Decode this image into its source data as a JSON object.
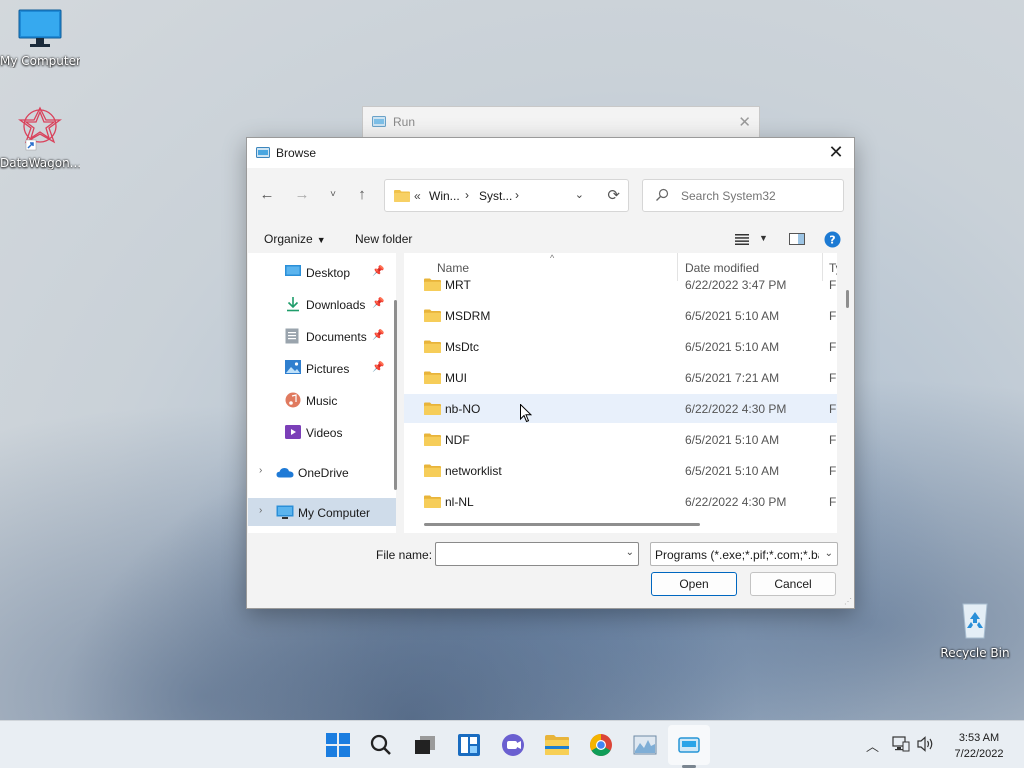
{
  "desktop": {
    "icons": [
      {
        "label": "My Computer"
      },
      {
        "label": "DataWagon..."
      },
      {
        "label": "Recycle Bin"
      }
    ]
  },
  "run_window": {
    "title": "Run"
  },
  "dialog": {
    "title": "Browse",
    "address": {
      "crumb_prefix": "«",
      "crumbs": [
        "Win...",
        "Syst..."
      ]
    },
    "search": {
      "placeholder": "Search System32",
      "value": ""
    },
    "commands": {
      "organize": "Organize",
      "new_folder": "New folder"
    },
    "nav": [
      {
        "label": "Desktop",
        "icon": "desktop-icon",
        "pinned": true
      },
      {
        "label": "Downloads",
        "icon": "downloads-icon",
        "pinned": true
      },
      {
        "label": "Documents",
        "icon": "documents-icon",
        "pinned": true
      },
      {
        "label": "Pictures",
        "icon": "pictures-icon",
        "pinned": true
      },
      {
        "label": "Music",
        "icon": "music-icon",
        "pinned": false
      },
      {
        "label": "Videos",
        "icon": "videos-icon",
        "pinned": false
      },
      {
        "label": "OneDrive",
        "icon": "onedrive-icon",
        "pinned": false
      },
      {
        "label": "My Computer",
        "icon": "computer-icon",
        "pinned": false,
        "selected": true
      }
    ],
    "columns": {
      "name": "Name",
      "date_modified": "Date modified",
      "type": "Ty"
    },
    "files": [
      {
        "name": "MRT",
        "date": "6/22/2022 3:47 PM",
        "type": "Fi"
      },
      {
        "name": "MSDRM",
        "date": "6/5/2021 5:10 AM",
        "type": "Fi"
      },
      {
        "name": "MsDtc",
        "date": "6/5/2021 5:10 AM",
        "type": "Fi"
      },
      {
        "name": "MUI",
        "date": "6/5/2021 7:21 AM",
        "type": "Fi"
      },
      {
        "name": "nb-NO",
        "date": "6/22/2022 4:30 PM",
        "type": "Fi",
        "hover": true
      },
      {
        "name": "NDF",
        "date": "6/5/2021 5:10 AM",
        "type": "Fi"
      },
      {
        "name": "networklist",
        "date": "6/5/2021 5:10 AM",
        "type": "Fi"
      },
      {
        "name": "nl-NL",
        "date": "6/22/2022 4:30 PM",
        "type": "Fi"
      }
    ],
    "file_name": {
      "label": "File name:",
      "value": ""
    },
    "file_type": {
      "selected": "Programs (*.exe;*.pif;*.com;*.bat)"
    },
    "buttons": {
      "open": "Open",
      "cancel": "Cancel"
    }
  },
  "taskbar": {
    "apps": [
      "start-icon",
      "search-icon",
      "task-view-icon",
      "widgets-icon",
      "chat-icon",
      "file-explorer-icon",
      "chrome-icon",
      "task-manager-icon",
      "run-icon"
    ],
    "clock": {
      "time": "3:53 AM",
      "date": "7/22/2022"
    }
  },
  "colors": {
    "accent": "#0067c0",
    "selection": "#cfdcea",
    "hover": "#e8f0fb",
    "folder": "#f0c24b"
  }
}
